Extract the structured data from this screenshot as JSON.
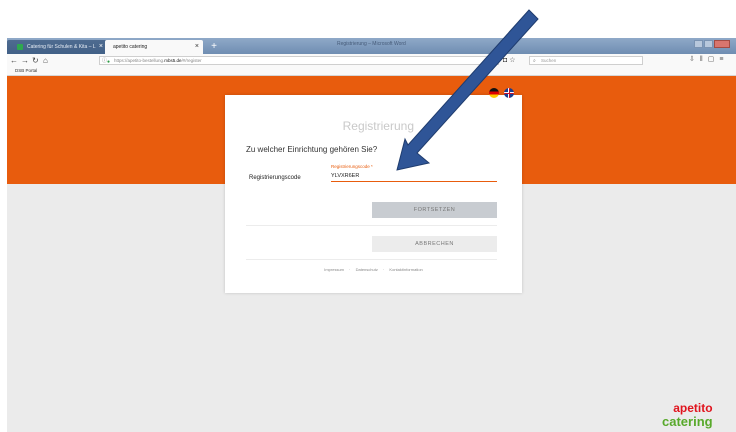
{
  "browser": {
    "tabs": [
      {
        "label": "Catering für Schulen & Kita – L",
        "active": false
      },
      {
        "label": "apetito catering",
        "active": true
      }
    ],
    "window_title": "Registrierung – Microsoft Word",
    "url": {
      "prefix": "https://apetito-bestellung.",
      "domain": "mbs5.de",
      "path": "/#/register"
    },
    "search_placeholder": "Suchen",
    "bookmark": "DSB Portal",
    "new_tab_glyph": "+",
    "close_glyph": "×"
  },
  "card": {
    "title": "Registrierung",
    "question": "Zu welcher Einrichtung gehören Sie?",
    "code_label": "Registrierungscode",
    "field_floating_label": "Registrierungscode *",
    "field_value": "YLVXR6ER",
    "continue_label": "FORTSETZEN",
    "cancel_label": "ABBRECHEN",
    "footer_links": [
      "Impressum",
      "Datenschutz",
      "Kontaktinformation"
    ],
    "footer_separator": "·"
  },
  "languages": [
    "de-flag-icon",
    "uk-flag-icon"
  ],
  "brand": {
    "line1": "apetito",
    "line2": "catering"
  },
  "colors": {
    "accent": "#e85c0d",
    "arrow": "#2f5597",
    "brand_red": "#e0141e",
    "brand_green": "#58a92b"
  }
}
